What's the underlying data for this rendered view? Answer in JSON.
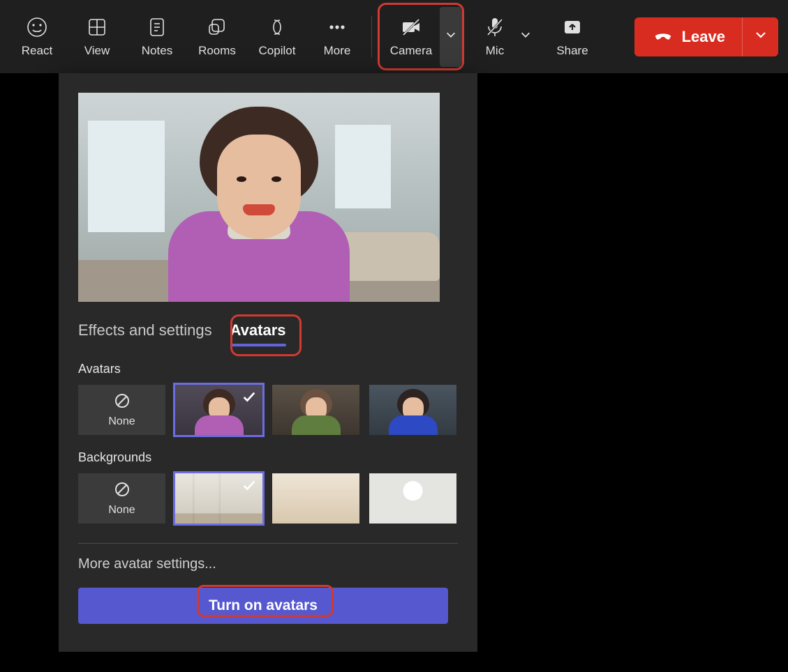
{
  "toolbar": {
    "react": {
      "label": "React"
    },
    "view": {
      "label": "View"
    },
    "notes": {
      "label": "Notes"
    },
    "rooms": {
      "label": "Rooms"
    },
    "copilot": {
      "label": "Copilot"
    },
    "more": {
      "label": "More"
    },
    "camera": {
      "label": "Camera"
    },
    "mic": {
      "label": "Mic"
    },
    "share": {
      "label": "Share"
    },
    "leave": {
      "label": "Leave"
    }
  },
  "panel": {
    "tabs": {
      "effects": "Effects and settings",
      "avatars": "Avatars"
    },
    "avatars_section_label": "Avatars",
    "none_label": "None",
    "backgrounds_section_label": "Backgrounds",
    "more_settings_label": "More avatar settings...",
    "turn_on_label": "Turn on avatars"
  }
}
